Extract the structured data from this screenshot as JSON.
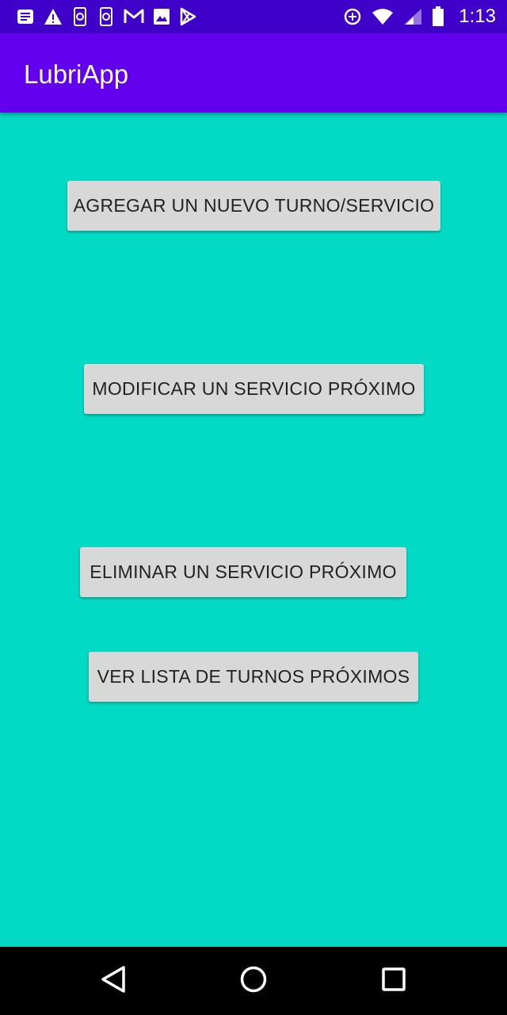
{
  "status_bar": {
    "time": "1:13",
    "icons_left": [
      "notes-icon",
      "warning-icon",
      "phone-sync-icon",
      "phone-sync-icon",
      "gmail-icon",
      "image-icon",
      "play-store-icon"
    ],
    "icons_right": [
      "data-saver-icon",
      "wifi-icon",
      "signal-icon",
      "battery-icon"
    ]
  },
  "app_bar": {
    "title": "LubriApp"
  },
  "buttons": {
    "agregar": "AGREGAR UN NUEVO TURNO/SERVICIO",
    "modificar": "MODIFICAR UN SERVICIO PRÓXIMO",
    "eliminar": "ELIMINAR UN SERVICIO PRÓXIMO",
    "ver_lista": "VER LISTA DE TURNOS PRÓXIMOS"
  },
  "nav_bar": {
    "icons": [
      "back-icon",
      "home-icon",
      "recents-icon"
    ]
  },
  "colors": {
    "status_bar": "#3F00C9",
    "app_bar": "#6200EE",
    "background": "#02DAC5",
    "button": "#D8D8D8",
    "button_text": "#222222",
    "nav_bar": "#000000"
  }
}
